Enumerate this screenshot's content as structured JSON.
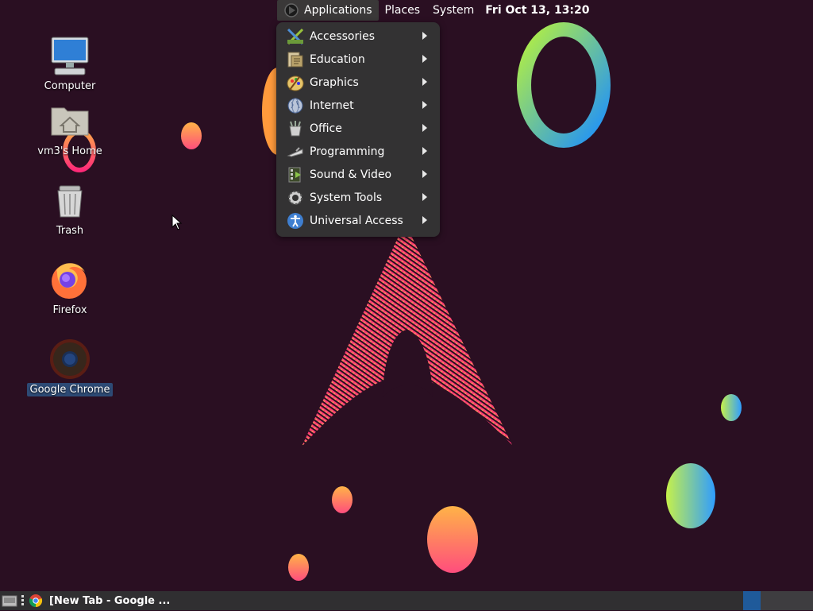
{
  "top_panel": {
    "menus": [
      {
        "label": "Applications",
        "active": true
      },
      {
        "label": "Places"
      },
      {
        "label": "System"
      }
    ],
    "clock": "Fri Oct 13, 13:20"
  },
  "applications_menu": {
    "items": [
      {
        "label": "Accessories",
        "icon": "accessories-icon"
      },
      {
        "label": "Education",
        "icon": "education-icon"
      },
      {
        "label": "Graphics",
        "icon": "graphics-icon"
      },
      {
        "label": "Internet",
        "icon": "internet-globe-icon"
      },
      {
        "label": "Office",
        "icon": "office-icon"
      },
      {
        "label": "Programming",
        "icon": "programming-icon"
      },
      {
        "label": "Sound & Video",
        "icon": "sound-video-icon"
      },
      {
        "label": "System Tools",
        "icon": "system-tools-gear-icon"
      },
      {
        "label": "Universal Access",
        "icon": "universal-access-icon"
      }
    ]
  },
  "desktop": {
    "icons": [
      {
        "label": "Computer",
        "icon": "computer-icon"
      },
      {
        "label": "vm3's Home",
        "icon": "home-folder-icon"
      },
      {
        "label": "Trash",
        "icon": "trash-icon"
      },
      {
        "label": "Firefox",
        "icon": "firefox-icon"
      },
      {
        "label": "Google Chrome",
        "icon": "chrome-icon",
        "selected": true
      }
    ]
  },
  "taskbar": {
    "task": "[New Tab - Google ...",
    "task_icon": "chrome-icon"
  },
  "colors": {
    "wallpaper_bg": "#2a0f22",
    "menu_bg": "#333233",
    "panel_bg": "#302f31",
    "workspace_active": "#1f5a9a",
    "selection": "#2d4a75"
  }
}
